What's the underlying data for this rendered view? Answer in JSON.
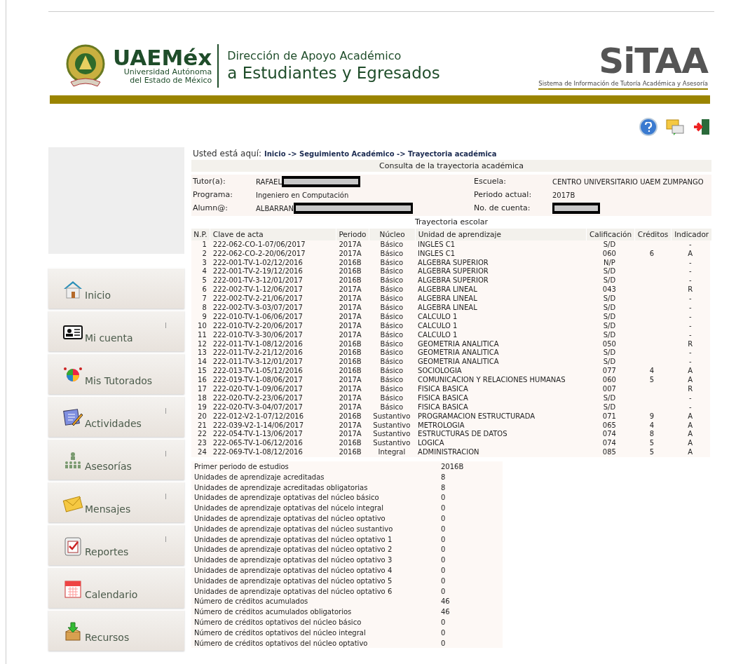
{
  "header": {
    "wordmark": "UAEMéx",
    "university": [
      "Universidad Autónoma",
      "del Estado de México"
    ],
    "department": [
      "Dirección de Apoyo Académico",
      "a Estudiantes y Egresados"
    ],
    "system_name": "SiTAA",
    "system_subtitle": "Sistema de Información de Tutoría Académica y Asesoría"
  },
  "sidebar": {
    "items": [
      {
        "label": "Inicio",
        "submenu": false
      },
      {
        "label": "Mi cuenta",
        "submenu": true
      },
      {
        "label": "Mis Tutorados",
        "submenu": false
      },
      {
        "label": "Actividades",
        "submenu": true
      },
      {
        "label": "Asesorías",
        "submenu": true
      },
      {
        "label": "Mensajes",
        "submenu": true
      },
      {
        "label": "Reportes",
        "submenu": true
      },
      {
        "label": "Calendario",
        "submenu": false
      },
      {
        "label": "Recursos",
        "submenu": false
      }
    ]
  },
  "breadcrumb": {
    "prefix": "Usted está aquí:",
    "path": "Inicio -> Seguimiento Académico -> Trayectoria académica"
  },
  "consulta": {
    "title": "Consulta de la trayectoria académica",
    "rows": [
      {
        "left": {
          "label": "Tutor(a):",
          "value": "RAFAEL",
          "redacted": true
        },
        "right": {
          "label": "Escuela:",
          "value": "CENTRO UNIVERSITARIO UAEM ZUMPANGO",
          "redacted": false
        }
      },
      {
        "left": {
          "label": "Programa:",
          "value": "Ingeniero en Computación",
          "redacted": false
        },
        "right": {
          "label": "Periodo actual:",
          "value": "2017B",
          "redacted": false
        }
      },
      {
        "left": {
          "label": "Alumn@:",
          "value": "ALBARRAN",
          "redacted": true
        },
        "right": {
          "label": "No. de cuenta:",
          "redacted": true
        }
      }
    ]
  },
  "trayectoria": {
    "title": "Trayectoria escolar",
    "columns": [
      "N.P.",
      "Clave de acta",
      "Periodo",
      "Núcleo",
      "Unidad de aprendizaje",
      "Calificación",
      "Créditos",
      "Indicador"
    ],
    "rows": [
      [
        "1",
        "222-062-CO-1-07/06/2017",
        "2017A",
        "Básico",
        "INGLES C1",
        "S/D",
        "",
        "-"
      ],
      [
        "2",
        "222-062-CO-2-20/06/2017",
        "2017A",
        "Básico",
        "INGLES C1",
        "060",
        "6",
        "A"
      ],
      [
        "3",
        "222-001-TV-1-02/12/2016",
        "2016B",
        "Básico",
        "ALGEBRA SUPERIOR",
        "N/P",
        "",
        "-"
      ],
      [
        "4",
        "222-001-TV-2-19/12/2016",
        "2016B",
        "Básico",
        "ALGEBRA SUPERIOR",
        "S/D",
        "",
        "-"
      ],
      [
        "5",
        "222-001-TV-3-12/01/2017",
        "2016B",
        "Básico",
        "ALGEBRA SUPERIOR",
        "S/D",
        "",
        "-"
      ],
      [
        "6",
        "222-002-TV-1-12/06/2017",
        "2017A",
        "Básico",
        "ALGEBRA LINEAL",
        "043",
        "",
        "R"
      ],
      [
        "7",
        "222-002-TV-2-21/06/2017",
        "2017A",
        "Básico",
        "ALGEBRA LINEAL",
        "S/D",
        "",
        "-"
      ],
      [
        "8",
        "222-002-TV-3-03/07/2017",
        "2017A",
        "Básico",
        "ALGEBRA LINEAL",
        "S/D",
        "",
        "-"
      ],
      [
        "9",
        "222-010-TV-1-06/06/2017",
        "2017A",
        "Básico",
        "CALCULO 1",
        "S/D",
        "",
        "-"
      ],
      [
        "10",
        "222-010-TV-2-20/06/2017",
        "2017A",
        "Básico",
        "CALCULO 1",
        "S/D",
        "",
        "-"
      ],
      [
        "11",
        "222-010-TV-3-30/06/2017",
        "2017A",
        "Básico",
        "CALCULO 1",
        "S/D",
        "",
        "-"
      ],
      [
        "12",
        "222-011-TV-1-08/12/2016",
        "2016B",
        "Básico",
        "GEOMETRIA ANALITICA",
        "050",
        "",
        "R"
      ],
      [
        "13",
        "222-011-TV-2-21/12/2016",
        "2016B",
        "Básico",
        "GEOMETRIA ANALITICA",
        "S/D",
        "",
        "-"
      ],
      [
        "14",
        "222-011-TV-3-12/01/2017",
        "2016B",
        "Básico",
        "GEOMETRIA ANALITICA",
        "S/D",
        "",
        "-"
      ],
      [
        "15",
        "222-013-TV-1-05/12/2016",
        "2016B",
        "Básico",
        "SOCIOLOGIA",
        "077",
        "4",
        "A"
      ],
      [
        "16",
        "222-019-TV-1-08/06/2017",
        "2017A",
        "Básico",
        "COMUNICACION Y RELACIONES HUMANAS",
        "060",
        "5",
        "A"
      ],
      [
        "17",
        "222-020-TV-1-09/06/2017",
        "2017A",
        "Básico",
        "FISICA BASICA",
        "007",
        "",
        "R"
      ],
      [
        "18",
        "222-020-TV-2-23/06/2017",
        "2017A",
        "Básico",
        "FISICA BASICA",
        "S/D",
        "",
        "-"
      ],
      [
        "19",
        "222-020-TV-3-04/07/2017",
        "2017A",
        "Básico",
        "FISICA BASICA",
        "S/D",
        "",
        "-"
      ],
      [
        "20",
        "222-012-V2-1-07/12/2016",
        "2016B",
        "Sustantivo",
        "PROGRAMACION ESTRUCTURADA",
        "071",
        "9",
        "A"
      ],
      [
        "21",
        "222-039-V2-1-14/06/2017",
        "2017A",
        "Sustantivo",
        "METROLOGIA",
        "065",
        "4",
        "A"
      ],
      [
        "22",
        "222-054-TV-1-13/06/2017",
        "2017A",
        "Sustantivo",
        "ESTRUCTURAS DE DATOS",
        "074",
        "8",
        "A"
      ],
      [
        "23",
        "222-065-TV-1-06/12/2016",
        "2016B",
        "Sustantivo",
        "LOGICA",
        "074",
        "5",
        "A"
      ],
      [
        "24",
        "222-069-TV-1-08/12/2016",
        "2016B",
        "Integral",
        "ADMINISTRACION",
        "085",
        "5",
        "A"
      ]
    ]
  },
  "summary": [
    {
      "label": "Primer periodo de estudios",
      "value": "2016B"
    },
    {
      "label": "Unidades de aprendizaje acreditadas",
      "value": "8"
    },
    {
      "label": "Unidades de aprendizaje acreditadas obligatorias",
      "value": "8"
    },
    {
      "label": "Unidades de aprendizaje optativas del núcleo básico",
      "value": "0"
    },
    {
      "label": "Unidades de aprendizaje optativas del núcelo integral",
      "value": "0"
    },
    {
      "label": "Unidades de aprendizaje optativas del núcleo optativo",
      "value": "0"
    },
    {
      "label": "Unidades de aprendizaje optativas del núcleo sustantivo",
      "value": "0"
    },
    {
      "label": "Unidades de aprendizaje optativas del núcleo optativo 1",
      "value": "0"
    },
    {
      "label": "Unidades de aprendizaje optativas del núcleo optativo 2",
      "value": "0"
    },
    {
      "label": "Unidades de aprendizaje optativas del núcleo optativo 3",
      "value": "0"
    },
    {
      "label": "Unidades de aprendizaje optativas del núcleo optativo 4",
      "value": "0"
    },
    {
      "label": "Unidades de aprendizaje optativas del núcleo optativo 5",
      "value": "0"
    },
    {
      "label": "Unidades de aprendizaje optativas del núcleo optativo 6",
      "value": "0"
    },
    {
      "label": "Número de créditos acumulados",
      "value": "46"
    },
    {
      "label": "Número de créditos acumulados obligatorios",
      "value": "46"
    },
    {
      "label": "Número de créditos optativos del núcleo básico",
      "value": "0"
    },
    {
      "label": "Número de créditos optativos del núcleo integral",
      "value": "0"
    },
    {
      "label": "Número de créditos optativos del núcleo optativo",
      "value": "0"
    }
  ]
}
